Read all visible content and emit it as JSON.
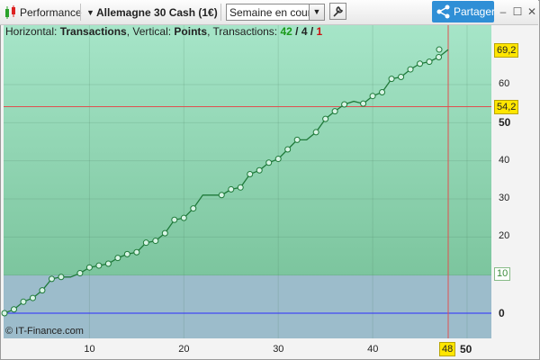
{
  "toolbar": {
    "perf_label": "Performance",
    "instrument": "Allemagne 30 Cash (1€)",
    "period_value": "Semaine en cours",
    "share_label": "Partager",
    "minimize": "–",
    "maximize": "☐",
    "close": "✕"
  },
  "info": {
    "prefix": "Horizontal: ",
    "horizontal": "Transactions",
    "mid": ", Vertical: ",
    "vertical": "Points",
    "tx_label": ", Transactions: ",
    "tx_total": "42",
    "slash1": " / ",
    "tx_neutral": "4",
    "slash2": " / ",
    "tx_loss": "1"
  },
  "copyright": "© IT-Finance.com",
  "colors": {
    "line": "#1f7a3a",
    "crosshair": "#e05050",
    "zero_line": "#2a2aff",
    "badge": "#ffe600"
  },
  "chart_data": {
    "type": "line",
    "xlabel": "Transactions",
    "ylabel": "Points",
    "xlim": [
      1,
      53
    ],
    "ylim": [
      -7,
      72
    ],
    "x_ticks": [
      "10",
      "20",
      "30",
      "40",
      "50"
    ],
    "y_ticks": [
      "0",
      "10",
      "20",
      "30",
      "40",
      "50",
      "60"
    ],
    "x_tick_values": [
      10,
      20,
      30,
      40,
      50
    ],
    "y_tick_values": [
      0,
      10,
      20,
      30,
      40,
      50,
      60
    ],
    "series": [
      {
        "x": [
          1,
          2,
          3,
          4,
          5,
          6,
          7,
          8,
          9,
          10,
          11,
          12,
          13,
          14,
          15,
          16,
          17,
          18,
          19,
          20,
          21,
          22,
          23,
          24,
          25,
          26,
          27,
          28,
          29,
          30,
          31,
          32,
          33,
          34,
          35,
          36,
          37,
          38,
          39,
          40,
          41,
          42,
          43,
          44,
          45,
          46,
          47
        ],
        "y": [
          0,
          1,
          3,
          4,
          6,
          9,
          9.5,
          9.5,
          10.5,
          12,
          12.5,
          13,
          14.5,
          15.5,
          16,
          18.5,
          19,
          21,
          24.5,
          25,
          27.5,
          31,
          31,
          31,
          32.5,
          33,
          36.5,
          37.5,
          39.5,
          40.5,
          43,
          45.5,
          45.5,
          47.5,
          51,
          53,
          54.8,
          55.6,
          55,
          57,
          58,
          61.5,
          62,
          64,
          65.5,
          66,
          67.2
        ],
        "markers": [
          true,
          true,
          true,
          true,
          true,
          true,
          true,
          false,
          true,
          true,
          true,
          true,
          true,
          true,
          true,
          true,
          true,
          true,
          true,
          true,
          true,
          false,
          false,
          true,
          true,
          true,
          true,
          true,
          true,
          true,
          true,
          true,
          false,
          true,
          true,
          true,
          true,
          false,
          true,
          true,
          true,
          true,
          true,
          true,
          true,
          true,
          true
        ]
      }
    ],
    "final_point": {
      "x": 48,
      "y": 69.2
    },
    "crosshair": {
      "x_label": "48",
      "y_label": "54,2",
      "y_value": 54.2
    },
    "last_value_label": "69,2",
    "threshold_label": "10",
    "threshold_value": 10
  },
  "axis": {
    "x_badge": "48",
    "x_end": "50"
  }
}
